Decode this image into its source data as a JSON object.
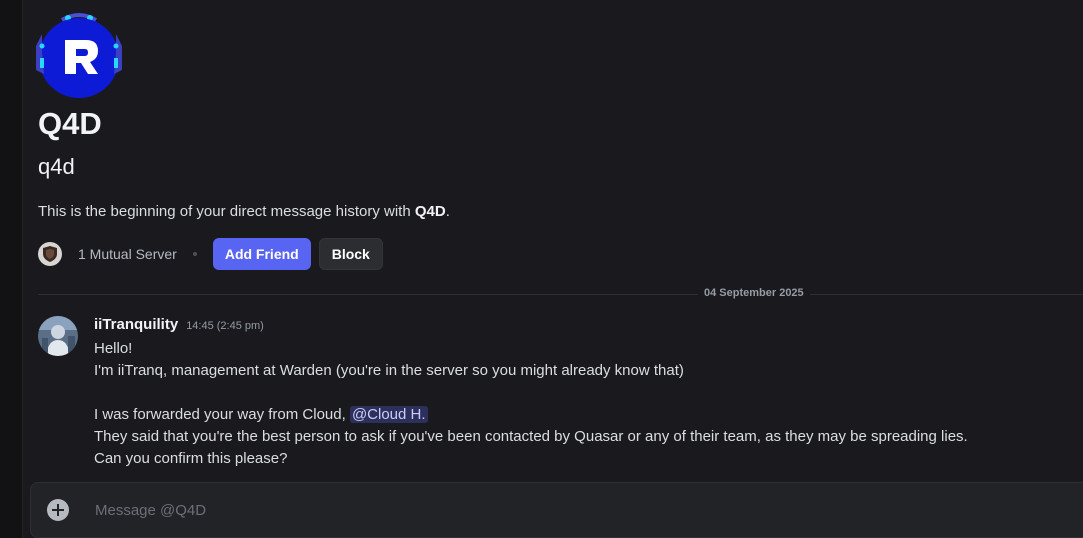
{
  "profile": {
    "display_name": "Q4D",
    "username": "q4d",
    "intro_prefix": "This is the beginning of your direct message history with ",
    "intro_name": "Q4D",
    "intro_suffix": ".",
    "avatar_icon": "robot-r-logo-icon",
    "avatar_letter": "R"
  },
  "actions": {
    "mutual_servers": "1 Mutual Server",
    "add_friend": "Add Friend",
    "block": "Block"
  },
  "divider": {
    "date": "04 September 2025"
  },
  "message": {
    "author": "iiTranquility",
    "timestamp": "14:45 (2:45 pm)",
    "lines": {
      "l1": "Hello!",
      "l2": "I'm iiTranq, management at Warden (you're in the server so you might already know that)",
      "l3_prefix": "I was forwarded your way from Cloud, ",
      "mention": "@Cloud H.",
      "l4": "They said that you're the best person to ask if you've been contacted by Quasar or any of their team, as they may be spreading lies.",
      "l5": "Can you confirm this please?"
    }
  },
  "composer": {
    "placeholder": "Message @Q4D"
  },
  "colors": {
    "background": "#1a1a1e",
    "accent": "#5865f2",
    "mention_bg": "#3c4270"
  }
}
